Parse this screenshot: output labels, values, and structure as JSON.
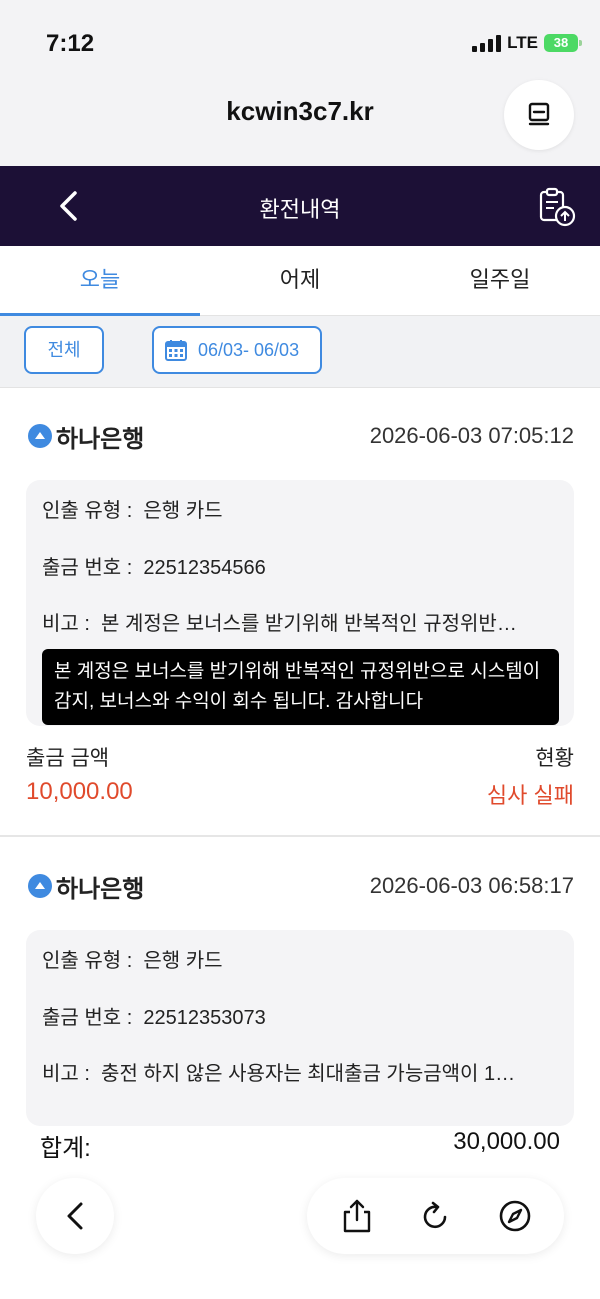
{
  "status_bar": {
    "time": "7:12",
    "network": "LTE",
    "battery": "38"
  },
  "browser": {
    "url": "kcwin3c7.kr"
  },
  "header": {
    "title": "환전내역"
  },
  "tabs": [
    {
      "label": "오늘",
      "active": true
    },
    {
      "label": "어제",
      "active": false
    },
    {
      "label": "일주일",
      "active": false
    }
  ],
  "filters": {
    "all_label": "전체",
    "date_range": "06/03- 06/03"
  },
  "records": [
    {
      "bank": "하나은행",
      "datetime": "2026-06-03 07:05:12",
      "type_label": "인출 유형 :",
      "type_value": "은행 카드",
      "number_label": "출금 번호 :",
      "number_value": "22512354566",
      "note_label": "비고 :",
      "note_value": "본 계정은 보너스를 받기위해 반복적인 규정위반…",
      "tooltip": "본 계정은 보너스를 받기위해 반복적인 규정위반으로 시스템이 감지, 보너스와 수익이 회수 됩니다. 감사합니다",
      "amount_label": "출금 금액",
      "amount": "10,000.00",
      "status_label": "현황",
      "status": "심사 실패"
    },
    {
      "bank": "하나은행",
      "datetime": "2026-06-03 06:58:17",
      "type_label": "인출 유형 :",
      "type_value": "은행 카드",
      "number_label": "출금 번호 :",
      "number_value": "22512353073",
      "note_label": "비고 :",
      "note_value": "충전 하지 않은 사용자는 최대출금 가능금액이 1…"
    }
  ],
  "total": {
    "label": "합계:",
    "value": "30,000.00"
  },
  "colors": {
    "accent": "#3f8ae0",
    "header_bg": "#1c1036",
    "danger": "#e04a2c"
  },
  "icons": {
    "back": "chevron-left-icon",
    "clipboard": "clipboard-upload-icon",
    "calendar": "calendar-icon",
    "bank": "bank-logo-icon",
    "share": "share-icon",
    "reload": "reload-icon",
    "compass": "compass-icon"
  }
}
